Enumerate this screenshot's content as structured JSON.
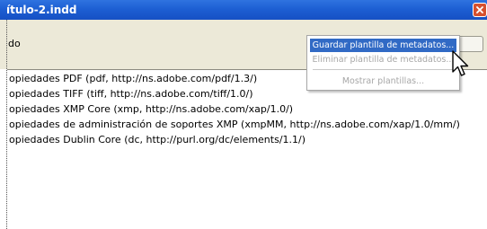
{
  "window": {
    "title": "ítulo-2.indd",
    "close_icon": "close-icon"
  },
  "toolbar": {
    "label": "do"
  },
  "menu": {
    "items": [
      {
        "label": "Guardar plantilla de metadatos...",
        "state": "selected"
      },
      {
        "label": "Eliminar plantilla de metadatos...",
        "state": "disabled"
      },
      {
        "label": "Mostrar plantillas...",
        "state": "disabled"
      }
    ]
  },
  "schemas": [
    "opiedades PDF (pdf, http://ns.adobe.com/pdf/1.3/)",
    "opiedades TIFF (tiff, http://ns.adobe.com/tiff/1.0/)",
    "opiedades XMP Core (xmp, http://ns.adobe.com/xap/1.0/)",
    "opiedades de administración de soportes XMP (xmpMM, http://ns.adobe.com/xap/1.0/mm/)",
    "opiedades Dublin Core (dc, http://purl.org/dc/elements/1.1/)"
  ],
  "cursor": "arrow-cursor-icon",
  "colors": {
    "titlebar": "#1d5fd3",
    "close_button": "#d6502f",
    "menu_highlight": "#316ac5",
    "disabled_text": "#a7a7a7",
    "toolbar_bg": "#ece9d8"
  }
}
